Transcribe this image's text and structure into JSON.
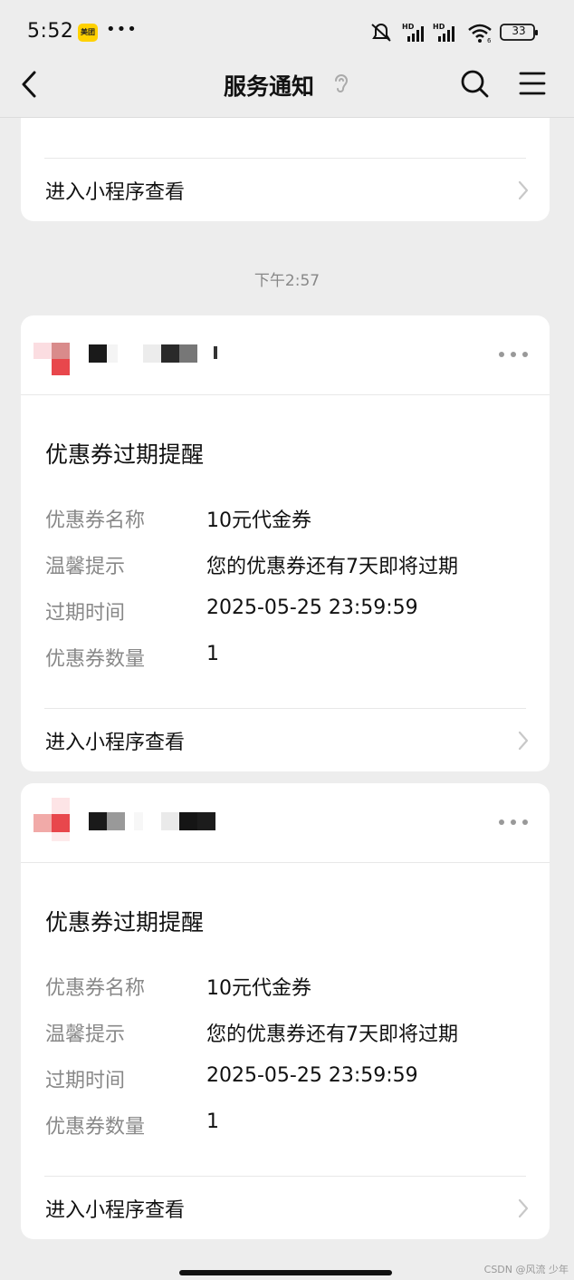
{
  "status_bar": {
    "time": "5:52",
    "app_badge": "美团",
    "more": "•••",
    "battery": "33"
  },
  "nav": {
    "title": "服务通知",
    "back_icon": "chevron-left-icon",
    "ear_icon": "ear-icon",
    "search_icon": "search-icon",
    "menu_icon": "menu-icon"
  },
  "top_card": {
    "enter_label": "进入小程序查看"
  },
  "timestamp": "下午2:57",
  "notices": [
    {
      "title": "优惠券过期提醒",
      "fields": [
        {
          "label": "优惠券名称",
          "value": "10元代金券"
        },
        {
          "label": "温馨提示",
          "value": "您的优惠券还有7天即将过期"
        },
        {
          "label": "过期时间",
          "value": "2025-05-25 23:59:59"
        },
        {
          "label": "优惠券数量",
          "value": "1"
        }
      ],
      "enter_label": "进入小程序查看"
    },
    {
      "title": "优惠券过期提醒",
      "fields": [
        {
          "label": "优惠券名称",
          "value": "10元代金券"
        },
        {
          "label": "温馨提示",
          "value": "您的优惠券还有7天即将过期"
        },
        {
          "label": "过期时间",
          "value": "2025-05-25 23:59:59"
        },
        {
          "label": "优惠券数量",
          "value": "1"
        }
      ],
      "enter_label": "进入小程序查看"
    }
  ],
  "watermark": "CSDN @风流 少年",
  "colors": {
    "background": "#ededed",
    "card": "#ffffff",
    "label_gray": "#888888",
    "brand_yellow": "#ffd100"
  }
}
